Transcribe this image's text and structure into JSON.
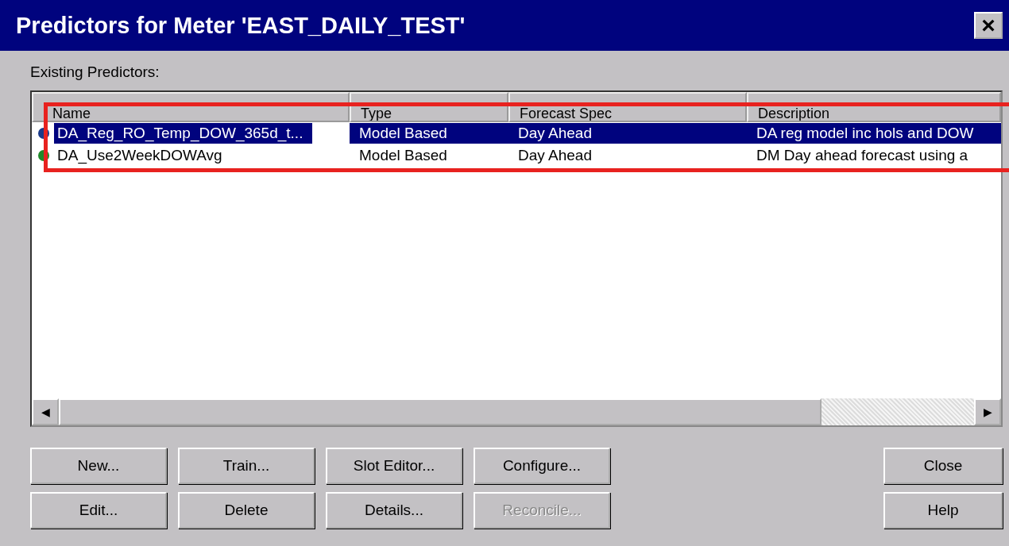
{
  "window": {
    "title": "Predictors for Meter 'EAST_DAILY_TEST'",
    "close": "×"
  },
  "list_label": "Existing Predictors:",
  "table": {
    "columns": [
      "Name",
      "Type",
      "Forecast Spec",
      "Description"
    ],
    "rows": [
      {
        "selected": true,
        "color": "#1a3a8a",
        "cells": [
          "DA_Reg_RO_Temp_DOW_365d_t...",
          "Model Based",
          "Day Ahead",
          "DA reg model inc hols and DOW"
        ]
      },
      {
        "selected": false,
        "color": "#1f8a2a",
        "cells": [
          "DA_Use2WeekDOWAvg",
          "Model Based",
          "Day Ahead",
          "DM Day ahead forecast using a"
        ]
      }
    ]
  },
  "scrollbar": {
    "left": "◀",
    "right": "▶"
  },
  "buttons": [
    {
      "label": "New...",
      "disabled": false
    },
    {
      "label": "Train...",
      "disabled": false
    },
    {
      "label": "Slot Editor...",
      "disabled": false
    },
    {
      "label": "Configure...",
      "disabled": false
    },
    {
      "label": "Edit...",
      "disabled": false
    },
    {
      "label": "Delete",
      "disabled": false
    },
    {
      "label": "Details...",
      "disabled": false
    },
    {
      "label": "Reconcile...",
      "disabled": true
    }
  ],
  "side_buttons": [
    {
      "label": "Close",
      "disabled": false
    },
    {
      "label": "Help",
      "disabled": false
    }
  ],
  "highlight": {
    "shown": true
  }
}
